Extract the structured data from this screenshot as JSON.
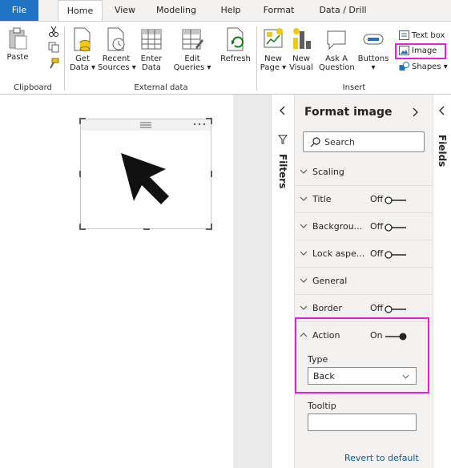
{
  "tabs": [
    {
      "label": "File"
    },
    {
      "label": "Home"
    },
    {
      "label": "View"
    },
    {
      "label": "Modeling"
    },
    {
      "label": "Help"
    },
    {
      "label": "Format"
    },
    {
      "label": "Data / Drill"
    }
  ],
  "ribbon": {
    "paste": "Paste",
    "get_data": [
      "Get",
      "Data ▾"
    ],
    "recent_sources": [
      "Recent",
      "Sources ▾"
    ],
    "enter_data": [
      "Enter",
      "Data"
    ],
    "edit_queries": [
      "Edit",
      "Queries ▾"
    ],
    "refresh": "Refresh",
    "new_page": [
      "New",
      "Page ▾"
    ],
    "new_visual": [
      "New",
      "Visual"
    ],
    "ask_question": [
      "Ask A",
      "Question"
    ],
    "buttons": [
      "Buttons",
      "▾"
    ],
    "text_box": "Text box",
    "image": "Image",
    "shapes": "Shapes ▾",
    "groups": {
      "clipboard": "Clipboard",
      "external_data": "External data",
      "insert": "Insert"
    }
  },
  "filters_pane": {
    "label": "Filters"
  },
  "fields_pane": {
    "label": "Fields"
  },
  "format_pane": {
    "title": "Format image",
    "search_placeholder": "Search",
    "sections": [
      {
        "label": "Scaling",
        "state": ""
      },
      {
        "label": "Title",
        "state": "Off"
      },
      {
        "label": "Backgrou...",
        "state": "Off"
      },
      {
        "label": "Lock aspe...",
        "state": "Off"
      },
      {
        "label": "General",
        "state": ""
      },
      {
        "label": "Border",
        "state": "Off"
      }
    ],
    "action": {
      "label": "Action",
      "state": "On",
      "type_label": "Type",
      "type_value": "Back",
      "tooltip_label": "Tooltip",
      "tooltip_value": ""
    },
    "revert": "Revert to default"
  },
  "colors": {
    "accent": "#1f72c4",
    "highlight": "#e91de0",
    "pane_bg": "#f3f2f1"
  }
}
